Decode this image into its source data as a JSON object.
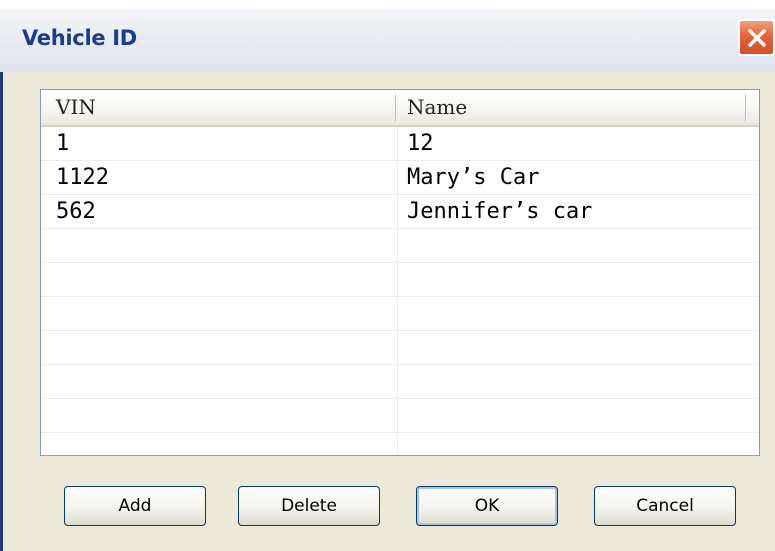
{
  "window": {
    "title": "Vehicle ID",
    "close_icon": "close-icon",
    "accent_color": "#1a3c8c",
    "close_color": "#e2643a"
  },
  "list": {
    "columns": [
      "VIN",
      "Name"
    ],
    "rows": [
      {
        "vin": "1",
        "name": "12"
      },
      {
        "vin": "1122",
        "name": "Mary’s Car"
      },
      {
        "vin": "562",
        "name": "Jennifer’s car"
      },
      {
        "vin": "",
        "name": ""
      },
      {
        "vin": "",
        "name": ""
      },
      {
        "vin": "",
        "name": ""
      },
      {
        "vin": "",
        "name": ""
      },
      {
        "vin": "",
        "name": ""
      },
      {
        "vin": "",
        "name": ""
      },
      {
        "vin": "",
        "name": ""
      }
    ]
  },
  "buttons": {
    "add": "Add",
    "delete": "Delete",
    "ok": "OK",
    "cancel": "Cancel"
  }
}
